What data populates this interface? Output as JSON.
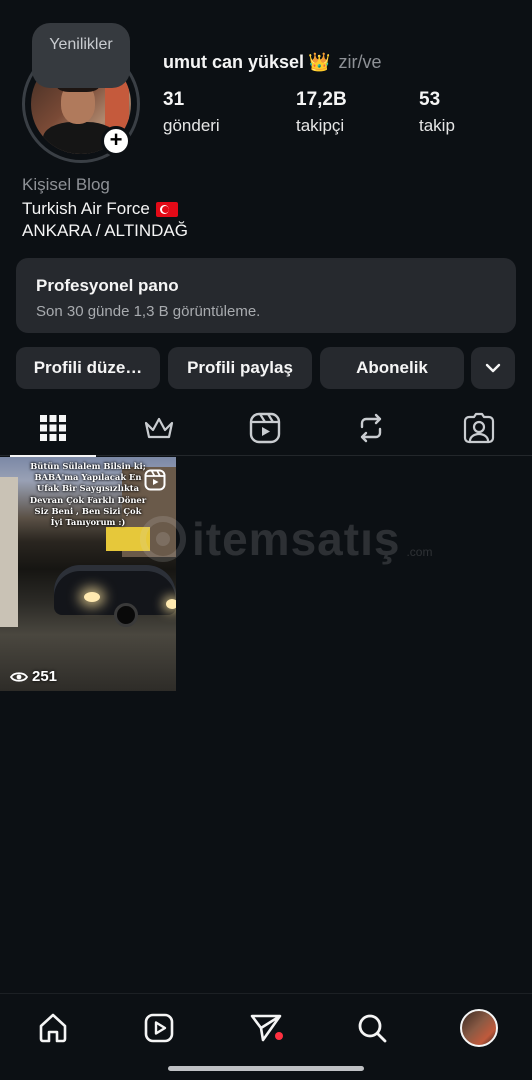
{
  "profile": {
    "note": "Yenilikler",
    "username": "umut can yüksel",
    "crown_emoji": "👑",
    "handle": "zir/ve",
    "stats": [
      {
        "value": "31",
        "label": "gönderi"
      },
      {
        "value": "17,2B",
        "label": "takipçi"
      },
      {
        "value": "53",
        "label": "takip"
      }
    ],
    "category": "Kişisel Blog",
    "bio_line1": "Turkish Air Force",
    "bio_line2": "ANKARA / ALTINDAĞ"
  },
  "pro_panel": {
    "title": "Profesyonel pano",
    "subtitle": "Son 30 günde 1,3 B görüntüleme."
  },
  "actions": {
    "edit": "Profili düze…",
    "share": "Profili paylaş",
    "subscribe": "Abonelik"
  },
  "tabs": [
    {
      "icon": "grid-icon",
      "active": true
    },
    {
      "icon": "crown-icon"
    },
    {
      "icon": "reels-icon"
    },
    {
      "icon": "repost-icon"
    },
    {
      "icon": "tagged-icon"
    }
  ],
  "post": {
    "caption": "Bütün Sülalem Bilsin ki; BABA'ma Yapılacak En Ufak Bir Saygısızlıkta Devran Çok Farklı Döner Siz Beni , Ben Sizi Çok İyi Tanıyorum :)",
    "views": "251"
  },
  "watermark": {
    "text": "itemsatış",
    "suffix": ".com"
  },
  "bottom_nav": [
    {
      "icon": "home-icon"
    },
    {
      "icon": "reels-icon"
    },
    {
      "icon": "direct-message-icon"
    },
    {
      "icon": "search-icon"
    },
    {
      "icon": "profile-avatar"
    }
  ],
  "colors": {
    "background": "#0c1014",
    "card": "#26292e",
    "notification": "#ff3040"
  }
}
